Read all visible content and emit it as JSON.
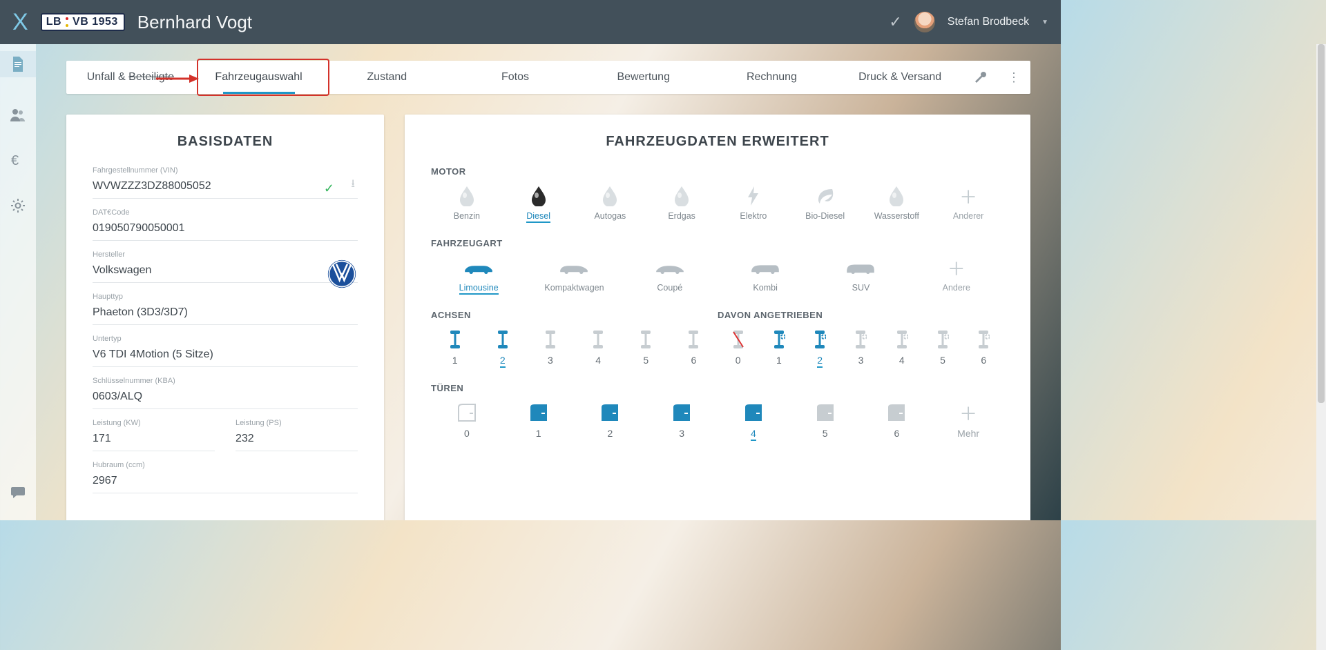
{
  "header": {
    "plate": "LB  VB 1953",
    "plate_left": "LB",
    "plate_right": "VB 1953",
    "customer": "Bernhard Vogt",
    "user": "Stefan Brodbeck"
  },
  "tabs": {
    "items": [
      {
        "label_a": "Unfall & ",
        "label_b": "Beteiligte"
      },
      {
        "label": "Fahrzeugauswahl"
      },
      {
        "label": "Zustand"
      },
      {
        "label": "Fotos"
      },
      {
        "label": "Bewertung"
      },
      {
        "label": "Rechnung"
      },
      {
        "label": "Druck & Versand"
      }
    ],
    "active_index": 1
  },
  "left_panel": {
    "title": "BASISDATEN",
    "fields": {
      "vin_label": "Fahrgestellnummer (VIN)",
      "vin": "WVWZZZ3DZ88005052",
      "datcode_label": "DAT€Code",
      "datcode": "019050790050001",
      "maker_label": "Hersteller",
      "maker": "Volkswagen",
      "main_label": "Haupttyp",
      "main": "Phaeton (3D3/3D7)",
      "sub_label": "Untertyp",
      "sub": "V6 TDI 4Motion (5 Sitze)",
      "kba_label": "Schlüsselnummer (KBA)",
      "kba": "0603/ALQ",
      "kw_label": "Leistung (KW)",
      "kw": "171",
      "ps_label": "Leistung (PS)",
      "ps": "232",
      "ccm_label": "Hubraum (ccm)",
      "ccm": "2967"
    }
  },
  "right_panel": {
    "title": "FAHRZEUGDATEN ERWEITERT",
    "motor_label": "MOTOR",
    "motor_opts": [
      "Benzin",
      "Diesel",
      "Autogas",
      "Erdgas",
      "Elektro",
      "Bio-Diesel",
      "Wasserstoff",
      "Anderer"
    ],
    "motor_selected": 1,
    "type_label": "FAHRZEUGART",
    "type_opts": [
      "Limousine",
      "Kompaktwagen",
      "Coupé",
      "Kombi",
      "SUV",
      "Andere"
    ],
    "type_selected": 0,
    "axles_label": "ACHSEN",
    "axles_opts": [
      "1",
      "2",
      "3",
      "4",
      "5",
      "6"
    ],
    "axles_selected": 1,
    "driven_label": "DAVON ANGETRIEBEN",
    "driven_opts": [
      "0",
      "1",
      "2",
      "3",
      "4",
      "5",
      "6"
    ],
    "driven_selected": 2,
    "doors_label": "TÜREN",
    "doors_opts": [
      "0",
      "1",
      "2",
      "3",
      "4",
      "5",
      "6",
      "Mehr"
    ],
    "doors_selected": 4
  }
}
